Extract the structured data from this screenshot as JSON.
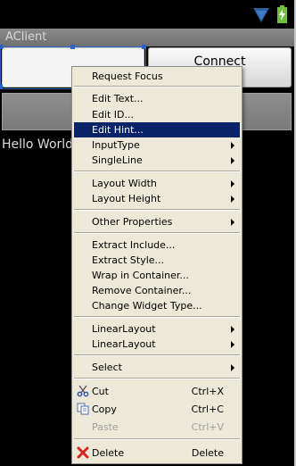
{
  "app": {
    "title": "AClient"
  },
  "main": {
    "connect_label": "Connect",
    "hello_text": "Hello World,"
  },
  "colors": {
    "selection_highlight": "#0a246a",
    "selection_outline": "#2a62c8",
    "menu_background": "#ece9d8"
  },
  "context_menu": {
    "request_focus": "Request Focus",
    "edit_text": "Edit Text...",
    "edit_id": "Edit ID...",
    "edit_hint": "Edit Hint...",
    "input_type": "InputType",
    "single_line": "SingleLine",
    "layout_width": "Layout Width",
    "layout_height": "Layout Height",
    "other_properties": "Other Properties",
    "extract_include": "Extract Include...",
    "extract_style": "Extract Style...",
    "wrap_in_container": "Wrap in Container...",
    "remove_container": "Remove Container...",
    "change_widget_type": "Change Widget Type...",
    "linear_layout_1": "LinearLayout",
    "linear_layout_2": "LinearLayout",
    "select": "Select",
    "cut": {
      "label": "Cut",
      "shortcut": "Ctrl+X",
      "icon": "scissors-icon"
    },
    "copy": {
      "label": "Copy",
      "shortcut": "Ctrl+C",
      "icon": "copy-icon"
    },
    "paste": {
      "label": "Paste",
      "shortcut": "Ctrl+V"
    },
    "delete": {
      "label": "Delete",
      "shortcut": "Delete",
      "icon": "delete-x-icon"
    }
  }
}
